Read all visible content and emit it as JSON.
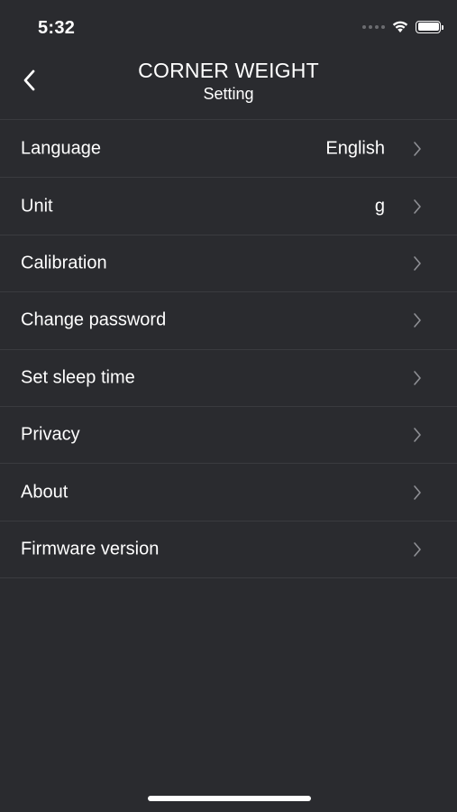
{
  "status_bar": {
    "time": "5:32",
    "icons": [
      "signal-icon",
      "wifi-icon",
      "battery-icon"
    ],
    "battery_level": 1.0
  },
  "nav": {
    "back_icon": "chevron-left-icon",
    "title": "CORNER WEIGHT",
    "subtitle": "Setting"
  },
  "settings": {
    "items": [
      {
        "label": "Language",
        "value": "English"
      },
      {
        "label": "Unit",
        "value": "g"
      },
      {
        "label": "Calibration",
        "value": ""
      },
      {
        "label": "Change password",
        "value": ""
      },
      {
        "label": "Set sleep time",
        "value": ""
      },
      {
        "label": "Privacy",
        "value": ""
      },
      {
        "label": "About",
        "value": ""
      },
      {
        "label": "Firmware version",
        "value": ""
      }
    ],
    "row_icon": "chevron-right-icon"
  },
  "colors": {
    "background": "#2a2b2f",
    "separator": "#3a3b3f",
    "text": "#ffffff",
    "chevron": "#8e8f94"
  }
}
